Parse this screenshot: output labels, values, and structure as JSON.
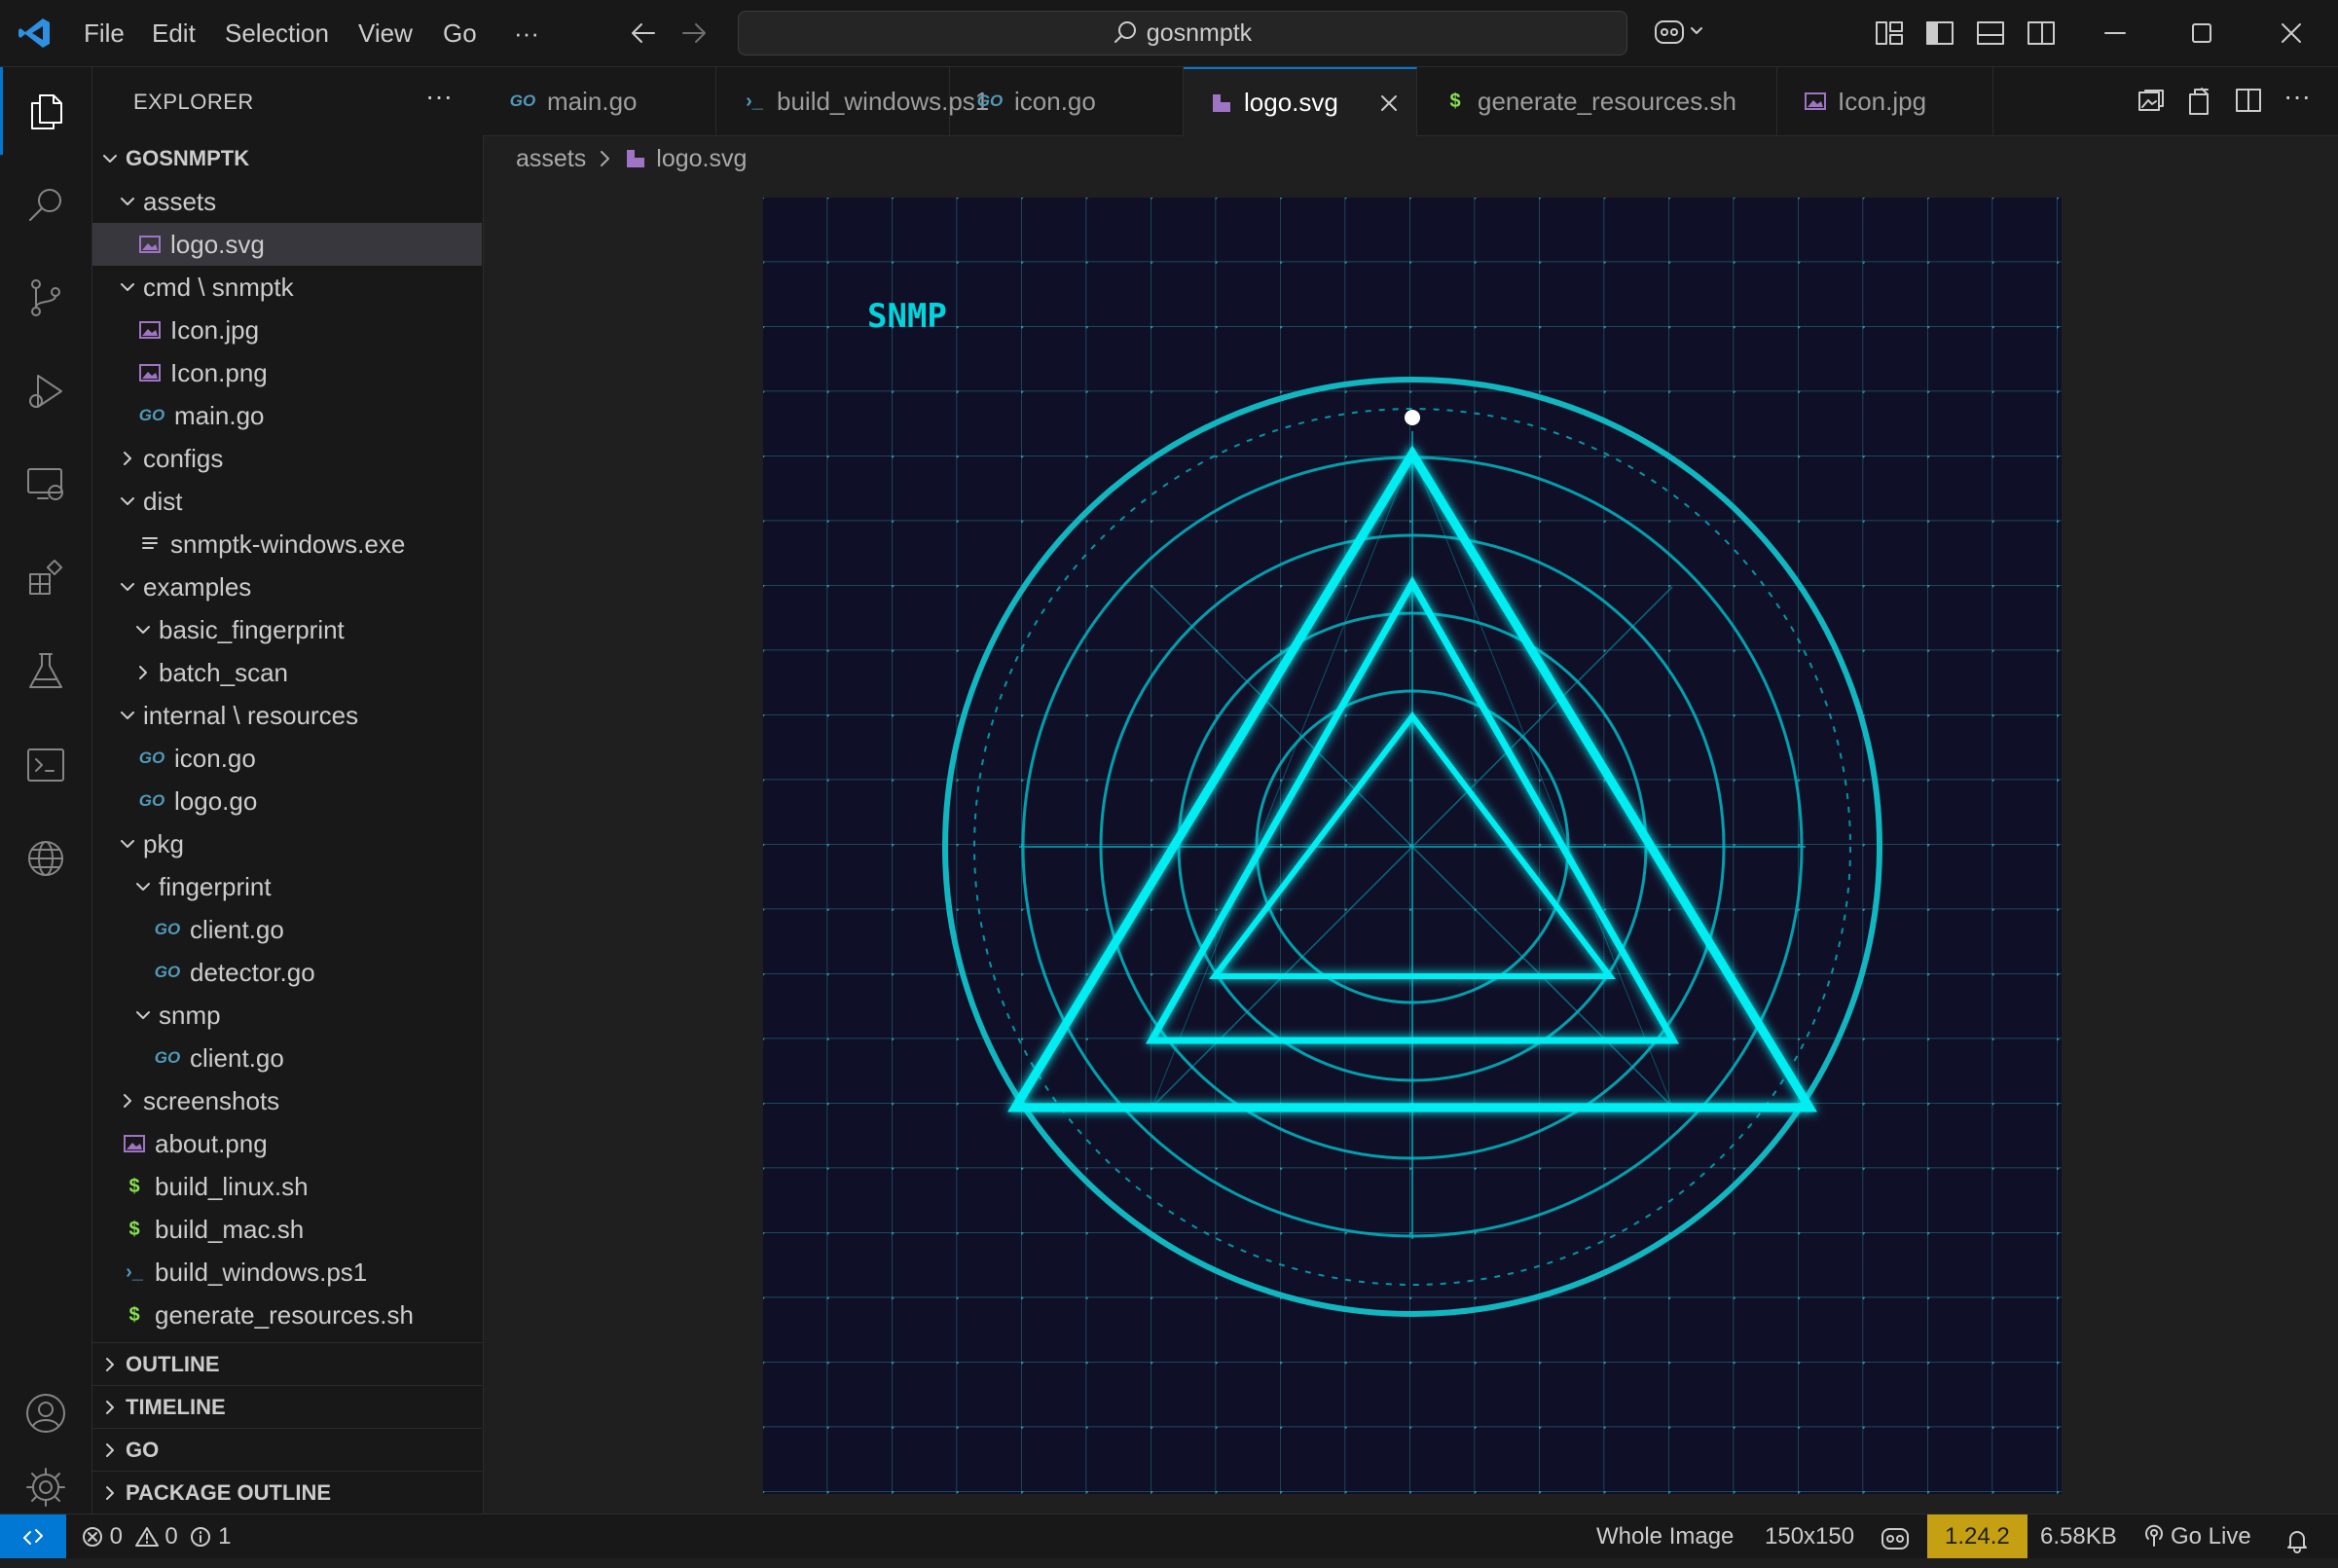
{
  "menu": [
    "File",
    "Edit",
    "Selection",
    "View",
    "Go",
    "···"
  ],
  "command_center": {
    "label": "gosnmptk"
  },
  "explorer": {
    "title": "EXPLORER",
    "more": "···",
    "root": "GOSNMPTK",
    "tree": [
      {
        "label": "assets",
        "depth": 1,
        "kind": "folder-open"
      },
      {
        "label": "logo.svg",
        "depth": 2,
        "kind": "image",
        "selected": true
      },
      {
        "label": "cmd \\ snmptk",
        "depth": 1,
        "kind": "folder-open"
      },
      {
        "label": "Icon.jpg",
        "depth": 2,
        "kind": "image"
      },
      {
        "label": "Icon.png",
        "depth": 2,
        "kind": "image"
      },
      {
        "label": "main.go",
        "depth": 2,
        "kind": "go"
      },
      {
        "label": "configs",
        "depth": 1,
        "kind": "folder-closed"
      },
      {
        "label": "dist",
        "depth": 1,
        "kind": "folder-open"
      },
      {
        "label": "snmptk-windows.exe",
        "depth": 2,
        "kind": "file"
      },
      {
        "label": "examples",
        "depth": 1,
        "kind": "folder-open"
      },
      {
        "label": "basic_fingerprint",
        "depth": 2,
        "kind": "folder-open"
      },
      {
        "label": "batch_scan",
        "depth": 2,
        "kind": "folder-closed"
      },
      {
        "label": "internal \\ resources",
        "depth": 1,
        "kind": "folder-open"
      },
      {
        "label": "icon.go",
        "depth": 2,
        "kind": "go"
      },
      {
        "label": "logo.go",
        "depth": 2,
        "kind": "go"
      },
      {
        "label": "pkg",
        "depth": 1,
        "kind": "folder-open"
      },
      {
        "label": "fingerprint",
        "depth": 2,
        "kind": "folder-open"
      },
      {
        "label": "client.go",
        "depth": 3,
        "kind": "go"
      },
      {
        "label": "detector.go",
        "depth": 3,
        "kind": "go"
      },
      {
        "label": "snmp",
        "depth": 2,
        "kind": "folder-open"
      },
      {
        "label": "client.go",
        "depth": 3,
        "kind": "go"
      },
      {
        "label": "screenshots",
        "depth": 1,
        "kind": "folder-closed"
      },
      {
        "label": "about.png",
        "depth": 1,
        "kind": "image"
      },
      {
        "label": "build_linux.sh",
        "depth": 1,
        "kind": "shell"
      },
      {
        "label": "build_mac.sh",
        "depth": 1,
        "kind": "shell"
      },
      {
        "label": "build_windows.ps1",
        "depth": 1,
        "kind": "powershell"
      },
      {
        "label": "generate_resources.sh",
        "depth": 1,
        "kind": "shell"
      }
    ],
    "sections": [
      "OUTLINE",
      "TIMELINE",
      "GO",
      "PACKAGE OUTLINE"
    ]
  },
  "tabs": [
    {
      "label": "main.go",
      "kind": "go"
    },
    {
      "label": "build_windows.ps1",
      "kind": "powershell"
    },
    {
      "label": "icon.go",
      "kind": "go"
    },
    {
      "label": "logo.svg",
      "kind": "image",
      "active": true
    },
    {
      "label": "generate_resources.sh",
      "kind": "shell"
    },
    {
      "label": "Icon.jpg",
      "kind": "image"
    }
  ],
  "breadcrumb": [
    "assets",
    "logo.svg"
  ],
  "preview": {
    "logo_text": "SNMP"
  },
  "icons": {
    "go": "GO",
    "shell": "$",
    "powershell": "›_",
    "image": "image-icon",
    "file": "file-icon"
  },
  "status": {
    "errors": "0",
    "warnings": "0",
    "info": "1",
    "zoom": "Whole Image",
    "size": "150x150",
    "go_version": "1.24.2",
    "filesize": "6.58KB",
    "go_live": "Go Live"
  },
  "colors": {
    "accent": "#0078d4",
    "logo_cyan": "#00e5ee",
    "logo_bg": "#0f1028",
    "go_version_bg": "#c5a013"
  }
}
